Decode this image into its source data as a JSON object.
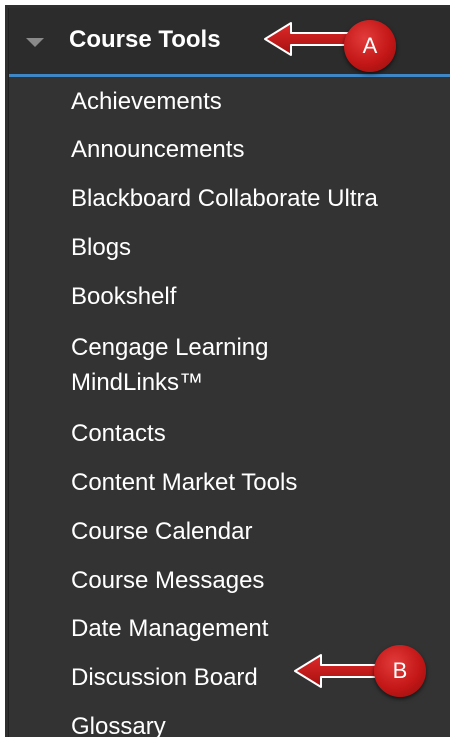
{
  "sidebar": {
    "section_title": "Course Tools",
    "items": [
      {
        "label": "Achievements"
      },
      {
        "label": "Announcements"
      },
      {
        "label": "Blackboard Collaborate Ultra"
      },
      {
        "label": "Blogs"
      },
      {
        "label": "Bookshelf"
      },
      {
        "label": "Cengage Learning\nMindLinks™"
      },
      {
        "label": "Contacts"
      },
      {
        "label": "Content Market Tools"
      },
      {
        "label": "Course Calendar"
      },
      {
        "label": "Course Messages"
      },
      {
        "label": "Date Management"
      },
      {
        "label": "Discussion Board"
      },
      {
        "label": "Glossary"
      }
    ]
  },
  "annotations": {
    "a": {
      "letter": "A"
    },
    "b": {
      "letter": "B"
    }
  },
  "colors": {
    "panel_background": "#333333",
    "accent_rule": "#3e86c6",
    "annotation_red": "#c41717",
    "text": "#ffffff"
  },
  "icons": {
    "section_toggle": "collapse-triangle-icon",
    "pointer": "arrow-left-icon"
  }
}
